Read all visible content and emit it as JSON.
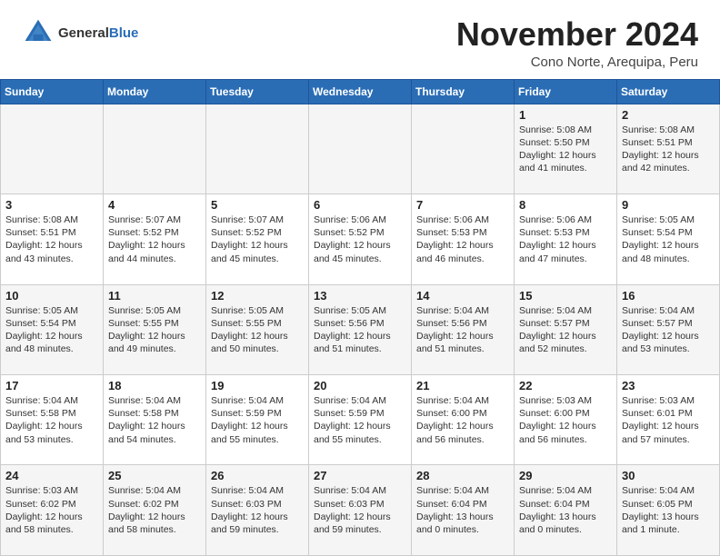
{
  "header": {
    "logo_general": "General",
    "logo_blue": "Blue",
    "month_year": "November 2024",
    "location": "Cono Norte, Arequipa, Peru"
  },
  "weekdays": [
    "Sunday",
    "Monday",
    "Tuesday",
    "Wednesday",
    "Thursday",
    "Friday",
    "Saturday"
  ],
  "weeks": [
    [
      {
        "day": "",
        "info": ""
      },
      {
        "day": "",
        "info": ""
      },
      {
        "day": "",
        "info": ""
      },
      {
        "day": "",
        "info": ""
      },
      {
        "day": "",
        "info": ""
      },
      {
        "day": "1",
        "info": "Sunrise: 5:08 AM\nSunset: 5:50 PM\nDaylight: 12 hours\nand 41 minutes."
      },
      {
        "day": "2",
        "info": "Sunrise: 5:08 AM\nSunset: 5:51 PM\nDaylight: 12 hours\nand 42 minutes."
      }
    ],
    [
      {
        "day": "3",
        "info": "Sunrise: 5:08 AM\nSunset: 5:51 PM\nDaylight: 12 hours\nand 43 minutes."
      },
      {
        "day": "4",
        "info": "Sunrise: 5:07 AM\nSunset: 5:52 PM\nDaylight: 12 hours\nand 44 minutes."
      },
      {
        "day": "5",
        "info": "Sunrise: 5:07 AM\nSunset: 5:52 PM\nDaylight: 12 hours\nand 45 minutes."
      },
      {
        "day": "6",
        "info": "Sunrise: 5:06 AM\nSunset: 5:52 PM\nDaylight: 12 hours\nand 45 minutes."
      },
      {
        "day": "7",
        "info": "Sunrise: 5:06 AM\nSunset: 5:53 PM\nDaylight: 12 hours\nand 46 minutes."
      },
      {
        "day": "8",
        "info": "Sunrise: 5:06 AM\nSunset: 5:53 PM\nDaylight: 12 hours\nand 47 minutes."
      },
      {
        "day": "9",
        "info": "Sunrise: 5:05 AM\nSunset: 5:54 PM\nDaylight: 12 hours\nand 48 minutes."
      }
    ],
    [
      {
        "day": "10",
        "info": "Sunrise: 5:05 AM\nSunset: 5:54 PM\nDaylight: 12 hours\nand 48 minutes."
      },
      {
        "day": "11",
        "info": "Sunrise: 5:05 AM\nSunset: 5:55 PM\nDaylight: 12 hours\nand 49 minutes."
      },
      {
        "day": "12",
        "info": "Sunrise: 5:05 AM\nSunset: 5:55 PM\nDaylight: 12 hours\nand 50 minutes."
      },
      {
        "day": "13",
        "info": "Sunrise: 5:05 AM\nSunset: 5:56 PM\nDaylight: 12 hours\nand 51 minutes."
      },
      {
        "day": "14",
        "info": "Sunrise: 5:04 AM\nSunset: 5:56 PM\nDaylight: 12 hours\nand 51 minutes."
      },
      {
        "day": "15",
        "info": "Sunrise: 5:04 AM\nSunset: 5:57 PM\nDaylight: 12 hours\nand 52 minutes."
      },
      {
        "day": "16",
        "info": "Sunrise: 5:04 AM\nSunset: 5:57 PM\nDaylight: 12 hours\nand 53 minutes."
      }
    ],
    [
      {
        "day": "17",
        "info": "Sunrise: 5:04 AM\nSunset: 5:58 PM\nDaylight: 12 hours\nand 53 minutes."
      },
      {
        "day": "18",
        "info": "Sunrise: 5:04 AM\nSunset: 5:58 PM\nDaylight: 12 hours\nand 54 minutes."
      },
      {
        "day": "19",
        "info": "Sunrise: 5:04 AM\nSunset: 5:59 PM\nDaylight: 12 hours\nand 55 minutes."
      },
      {
        "day": "20",
        "info": "Sunrise: 5:04 AM\nSunset: 5:59 PM\nDaylight: 12 hours\nand 55 minutes."
      },
      {
        "day": "21",
        "info": "Sunrise: 5:04 AM\nSunset: 6:00 PM\nDaylight: 12 hours\nand 56 minutes."
      },
      {
        "day": "22",
        "info": "Sunrise: 5:03 AM\nSunset: 6:00 PM\nDaylight: 12 hours\nand 56 minutes."
      },
      {
        "day": "23",
        "info": "Sunrise: 5:03 AM\nSunset: 6:01 PM\nDaylight: 12 hours\nand 57 minutes."
      }
    ],
    [
      {
        "day": "24",
        "info": "Sunrise: 5:03 AM\nSunset: 6:02 PM\nDaylight: 12 hours\nand 58 minutes."
      },
      {
        "day": "25",
        "info": "Sunrise: 5:04 AM\nSunset: 6:02 PM\nDaylight: 12 hours\nand 58 minutes."
      },
      {
        "day": "26",
        "info": "Sunrise: 5:04 AM\nSunset: 6:03 PM\nDaylight: 12 hours\nand 59 minutes."
      },
      {
        "day": "27",
        "info": "Sunrise: 5:04 AM\nSunset: 6:03 PM\nDaylight: 12 hours\nand 59 minutes."
      },
      {
        "day": "28",
        "info": "Sunrise: 5:04 AM\nSunset: 6:04 PM\nDaylight: 13 hours\nand 0 minutes."
      },
      {
        "day": "29",
        "info": "Sunrise: 5:04 AM\nSunset: 6:04 PM\nDaylight: 13 hours\nand 0 minutes."
      },
      {
        "day": "30",
        "info": "Sunrise: 5:04 AM\nSunset: 6:05 PM\nDaylight: 13 hours\nand 1 minute."
      }
    ]
  ]
}
